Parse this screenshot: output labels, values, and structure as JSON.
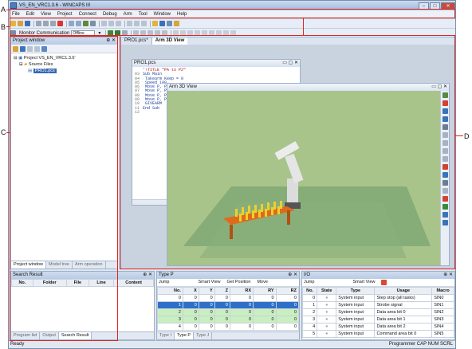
{
  "window": {
    "title": "VS_EN_VRC1.3.6 - WINCAPS III"
  },
  "menu": [
    "File",
    "Edit",
    "View",
    "Project",
    "Connect",
    "Debug",
    "Arm",
    "Tool",
    "Window",
    "Help"
  ],
  "toolbar": {
    "monitor_label": "Monitor Communication",
    "monitor_value": "Offline"
  },
  "project_window": {
    "title": "Project window",
    "tree": [
      "Project VS_EN_VRC1.3.6'",
      "Source Files",
      "PRO1.pcs"
    ],
    "tabs": [
      "Project window",
      "Model tree",
      "Arm operation"
    ]
  },
  "doc_tabs": [
    "PRO1.pcs*",
    "Arm 3D View"
  ],
  "code_window": {
    "title": "PRO1.pcs",
    "lines": [
      {
        "n": "",
        "t": "'!TITLE \"PA to P2\""
      },
      {
        "n": "03",
        "t": "Sub Main"
      },
      {
        "n": "04",
        "t": "  Takearm Keep = 0"
      },
      {
        "n": "05",
        "t": "  Speed 100"
      },
      {
        "n": "06",
        "t": "  Move P, P1"
      },
      {
        "n": "07",
        "t": "  Move P, P2"
      },
      {
        "n": "08",
        "t": "  Move P, P3"
      },
      {
        "n": "09",
        "t": "  Move P, P4"
      },
      {
        "n": "10",
        "t": "  GIVEARM"
      },
      {
        "n": "11",
        "t": "End Sub"
      },
      {
        "n": "12",
        "t": ""
      }
    ]
  },
  "arm_view": {
    "title": "Arm 3D View"
  },
  "search_result": {
    "title": "Search Result",
    "columns": [
      "No.",
      "Folder",
      "File",
      "Line",
      "Content"
    ],
    "tabs": [
      "Program list",
      "Output",
      "Search Result"
    ]
  },
  "type_p": {
    "title": "Type P",
    "toolbar": [
      "Jump",
      "Smart View",
      "Get Position",
      "Move"
    ],
    "columns": [
      "No.",
      "X",
      "Y",
      "Z",
      "RX",
      "RY",
      "RZ"
    ],
    "rows": [
      [
        "0",
        "0",
        "0",
        "0",
        "0",
        "0",
        "0"
      ],
      [
        "1",
        "0",
        "0",
        "0",
        "0",
        "0",
        "0"
      ],
      [
        "2",
        "0",
        "0",
        "0",
        "0",
        "0",
        "0"
      ],
      [
        "3",
        "0",
        "0",
        "0",
        "0",
        "0",
        "0"
      ],
      [
        "4",
        "0",
        "0",
        "0",
        "0",
        "0",
        "0"
      ]
    ],
    "tabs": [
      "Type I",
      "Type P",
      "Type J"
    ]
  },
  "io": {
    "title": "I/O",
    "toolbar": [
      "Jump",
      "Smart View"
    ],
    "columns": [
      "No.",
      "State",
      "Type",
      "Usage",
      "Macro"
    ],
    "rows": [
      [
        "0",
        "System input",
        "Step stop (all tasks)",
        "SIN0"
      ],
      [
        "1",
        "System input",
        "Strobe signal",
        "SIN1"
      ],
      [
        "2",
        "System input",
        "Data area bit 0",
        "SIN2"
      ],
      [
        "3",
        "System input",
        "Data area bit 1",
        "SIN3"
      ],
      [
        "4",
        "System input",
        "Data area bit 2",
        "SIN4"
      ],
      [
        "5",
        "System input",
        "Command area bit 0",
        "SIN5"
      ]
    ]
  },
  "status": {
    "left": "Ready",
    "right": "Programmer   CAP  NUM  SCRL"
  },
  "callouts": {
    "a": "A",
    "b": "B",
    "c": "C",
    "d": "D"
  }
}
